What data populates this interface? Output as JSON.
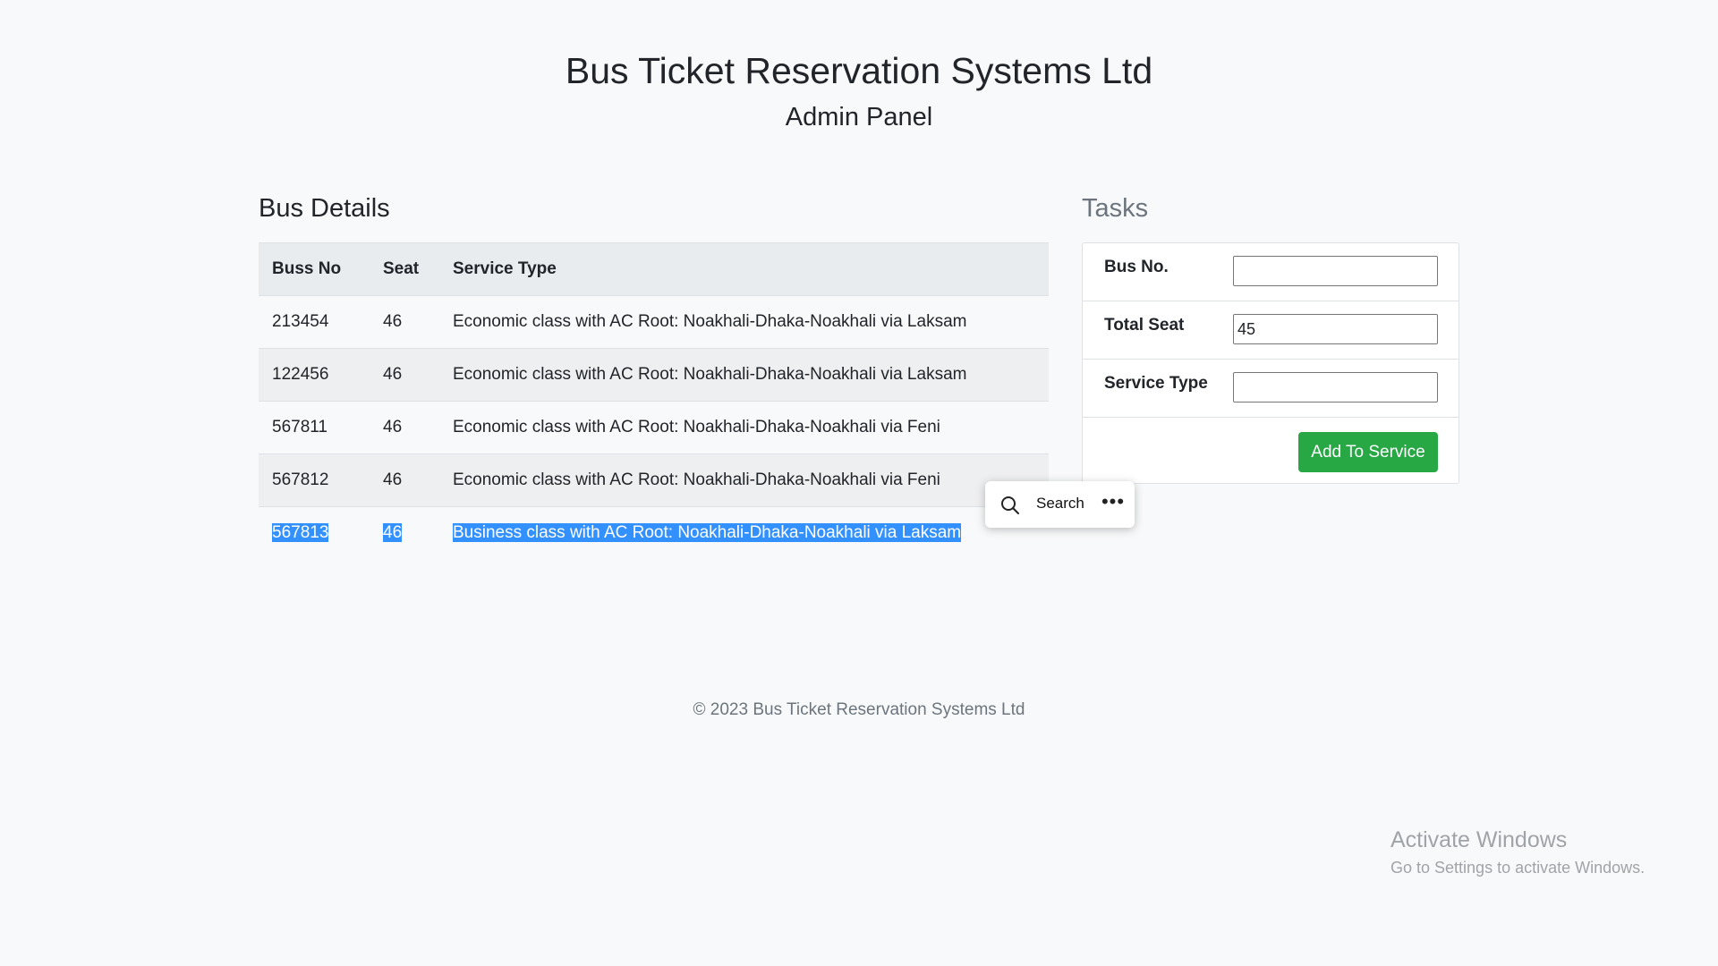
{
  "header": {
    "title": "Bus Ticket Reservation Systems Ltd",
    "subtitle": "Admin Panel"
  },
  "bus_details": {
    "heading": "Bus Details",
    "columns": [
      "Buss No",
      "Seat",
      "Service Type"
    ],
    "rows": [
      {
        "bus_no": "213454",
        "seat": "46",
        "service": "Economic class with AC Root: Noakhali-Dhaka-Noakhali via Laksam"
      },
      {
        "bus_no": "122456",
        "seat": "46",
        "service": "Economic class with AC Root: Noakhali-Dhaka-Noakhali via Laksam"
      },
      {
        "bus_no": "567811",
        "seat": "46",
        "service": "Economic class with AC Root: Noakhali-Dhaka-Noakhali via Feni"
      },
      {
        "bus_no": "567812",
        "seat": "46",
        "service": "Economic class with AC Root: Noakhali-Dhaka-Noakhali via Feni"
      },
      {
        "bus_no": "567813",
        "seat": "46",
        "service": "Business class with AC Root: Noakhali-Dhaka-Noakhali via Laksam"
      }
    ],
    "selected_row_index": 4
  },
  "tasks": {
    "heading": "Tasks",
    "fields": [
      {
        "label": "Bus No.",
        "value": ""
      },
      {
        "label": "Total Seat",
        "value": "45"
      },
      {
        "label": "Service Type",
        "value": ""
      }
    ],
    "submit_label": "Add To Service"
  },
  "context_popup": {
    "search_label": "Search",
    "search_icon": "search-icon",
    "more_icon": "more-horizontal-icon",
    "more_glyph": "•••"
  },
  "footer": {
    "copyright": "© 2023 Bus Ticket Reservation Systems Ltd"
  },
  "watermark": {
    "line1": "Activate Windows",
    "line2": "Go to Settings to activate Windows."
  },
  "colors": {
    "background": "#f8f9fa",
    "accent_green": "#28a745",
    "selection_blue": "#3390ff",
    "table_header_bg": "#e9ecef"
  }
}
